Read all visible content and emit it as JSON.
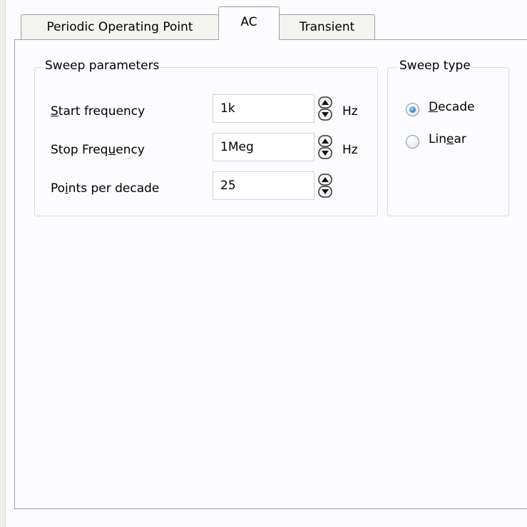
{
  "tabs": [
    {
      "label": "Periodic Operating Point",
      "active": false
    },
    {
      "label": "AC",
      "active": true
    },
    {
      "label": "Transient",
      "active": false
    }
  ],
  "sweep_parameters": {
    "title": "Sweep parameters",
    "start_frequency": {
      "label_mnemonic": "S",
      "label_rest": "tart frequency",
      "value": "1k",
      "unit": "Hz"
    },
    "stop_frequency": {
      "label_pre": "Stop Freq",
      "label_mnemonic": "u",
      "label_post": "ency",
      "value": "1Meg",
      "unit": "Hz"
    },
    "points_per_decade": {
      "label_pre": "Po",
      "label_mnemonic": "i",
      "label_post": "nts per decade",
      "value": "25"
    }
  },
  "sweep_type": {
    "title": "Sweep type",
    "decade": {
      "label_mnemonic": "D",
      "label_rest": "ecade",
      "checked": true
    },
    "linear": {
      "label_pre": "Lin",
      "label_mnemonic": "e",
      "label_post": "ar",
      "checked": false
    }
  },
  "colors": {
    "accent": "#3c8fd8",
    "border": "#9da0a2",
    "group_border": "#d3dbe3"
  }
}
